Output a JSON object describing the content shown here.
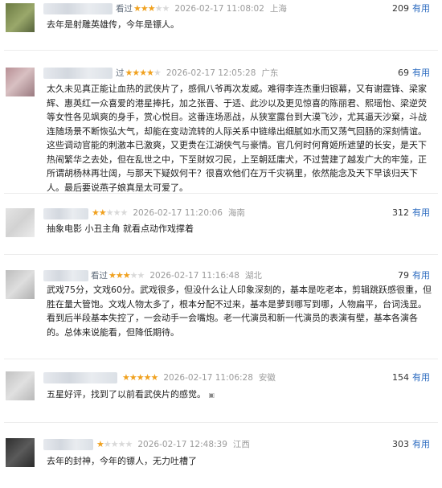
{
  "reviews": [
    {
      "user_visible": "",
      "action": "看过",
      "stars": [
        true,
        true,
        true,
        false,
        false
      ],
      "date": "2026-02-17 11:08:02",
      "location": "上海",
      "votes": "209",
      "vote_label": "有用",
      "content": "去年是射雕英雄传，今年是镖人。",
      "avatar_color": "#7d8c52"
    },
    {
      "user_visible": "",
      "action": "过",
      "stars": [
        true,
        true,
        true,
        true,
        false
      ],
      "date": "2026-02-17 12:05:28",
      "location": "广东",
      "votes": "69",
      "vote_label": "有用",
      "content": "太久未见真正能让血热的武侠片了，感佩八爷再次发威。难得李连杰重归银幕，又有谢霆锋、梁家辉、惠英红一众喜爱的港星捧托，加之张晋、于适、此沙以及更见惊喜的陈丽君、熙瑶怡、梁逆荧等女性各见飒爽的身手，赏心悦目。这番连场恶战，从狭室露台到大漠飞沙，尤其逼天沙窠，斗战连随场景不断恢弘大气，却能在变动流转的人际关系中链缘出细腻如水而又荡气回肠的深刻情谊。这些调动官能的刺激本已激爽，又更贵在江湖侠气与豪情。官几何时何育姬所遮望的长安，是天下热闹繁华之去处，但在乱世之中，下至财奴刁民，上至朝廷庸犬，不过营建了越发广大的牢笼，正所谓胡杨林再壮阔，与那天下疑奴何干？很喜欢他们在万千灾祸里，依然能念及天下早该归天下人。最后要说燕子娘真是太可爱了。",
      "avatar_color": "#c4a7a9"
    },
    {
      "user_visible": "",
      "action": "",
      "stars": [
        true,
        true,
        false,
        false,
        false
      ],
      "date": "2026-02-17 11:20:06",
      "location": "海南",
      "votes": "312",
      "vote_label": "有用",
      "content": "抽象电影 小丑主角 就看点动作戏撑着",
      "avatar_color": "#dddddd"
    },
    {
      "user_visible": "",
      "action": "看过",
      "stars": [
        true,
        true,
        true,
        false,
        false
      ],
      "date": "2026-02-17 11:16:48",
      "location": "湖北",
      "votes": "79",
      "vote_label": "有用",
      "content": "武戏75分，文戏60分。武戏很多，但没什么让人印象深刻的，基本是吃老本，剪辑跳跃感很重，但胜在量大管饱。文戏人物太多了，根本分配不过来，基本是萝到哪写到哪，人物扁平，台词浅显。看到后半段基本失控了，一会动手一会嘴炮。老一代演员和新一代演员的表演有壁，基本各演各的。总体来说能看，但降低期待。",
      "avatar_color": "#cfcfcf"
    },
    {
      "user_visible": "",
      "action": "",
      "stars": [
        true,
        true,
        true,
        true,
        true
      ],
      "date": "2026-02-17 11:06:28",
      "location": "安徽",
      "votes": "154",
      "vote_label": "有用",
      "content": "五星好评，找到了以前看武侠片的感觉。",
      "avatar_color": "#c9c9c9"
    },
    {
      "user_visible": "",
      "action": "",
      "stars": [
        true,
        false,
        false,
        false,
        false
      ],
      "date": "2026-02-17 12:48:39",
      "location": "江西",
      "votes": "303",
      "vote_label": "有用",
      "content": "去年的封神，今年的镖人，无力吐槽了",
      "avatar_color": "#3c3c3c"
    }
  ]
}
